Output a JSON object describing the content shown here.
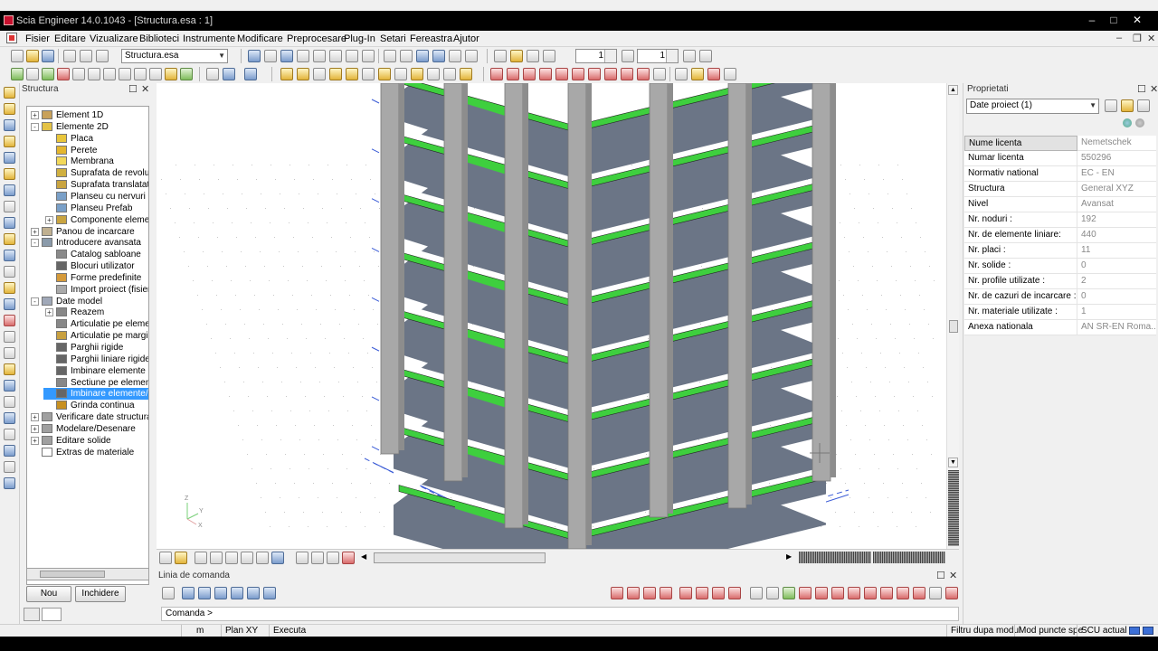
{
  "window": {
    "title": "Scia Engineer 14.0.1043 - [Structura.esa : 1]"
  },
  "menu": {
    "items": [
      "Fisier",
      "Editare",
      "Vizualizare",
      "Biblioteci",
      "Instrumente",
      "Modificare",
      "Preprocesare",
      "Plug-In",
      "Setari",
      "Fereastra",
      "Ajutor"
    ]
  },
  "toolbar": {
    "file_combo": "Structura.esa",
    "spin1": "1",
    "spin2": "1"
  },
  "structure_panel": {
    "title": "Structura",
    "tree": [
      "Element 1D",
      "Elemente 2D",
      "Placa",
      "Perete",
      "Membrana",
      "Suprafata de revoluti",
      "Suprafata translatata",
      "Planseu cu nervuri",
      "Planseu Prefab",
      "Componente elemen",
      "Panou de incarcare",
      "Introducere avansata",
      "Catalog sabloane",
      "Blocuri utilizator",
      "Forme predefinite",
      "Import proiect (fisier",
      "Date model",
      "Reazem",
      "Articulatie pe elemen",
      "Articulatie pe margin",
      "Parghii rigide",
      "Parghii liniare rigide",
      "Imbinare elemente i",
      "Sectiune pe element",
      "Imbinare elemente/",
      "Grinda continua",
      "Verificare date structura",
      "Modelare/Desenare",
      "Editare solide",
      "Extras de materiale"
    ],
    "btn_new": "Nou",
    "btn_close": "Inchidere"
  },
  "command_panel": {
    "title": "Linia de comanda",
    "prompt": "Comanda >"
  },
  "properties": {
    "title": "Proprietati",
    "combo": "Date proiect (1)",
    "rows": [
      {
        "k": "Nume licenta",
        "v": "Nemetschek"
      },
      {
        "k": "Numar licenta",
        "v": "550296"
      },
      {
        "k": "Normativ national",
        "v": "EC - EN"
      },
      {
        "k": "Structura",
        "v": "General XYZ"
      },
      {
        "k": "Nivel",
        "v": "Avansat"
      },
      {
        "k": "Nr. noduri :",
        "v": "192"
      },
      {
        "k": "Nr. de elemente liniare:",
        "v": "440"
      },
      {
        "k": "Nr. placi :",
        "v": "11"
      },
      {
        "k": "Nr. solide :",
        "v": "0"
      },
      {
        "k": "Nr. profile utilizate :",
        "v": "2"
      },
      {
        "k": "Nr. de cazuri de incarcare :",
        "v": "0"
      },
      {
        "k": "Nr. materiale utilizate :",
        "v": "1"
      },
      {
        "k": "Anexa nationala",
        "v": "AN SR-EN Roma..."
      }
    ]
  },
  "axes": {
    "z": "Z",
    "y": "Y",
    "x": "X"
  },
  "status": {
    "unit": "m",
    "plane": "Plan XY",
    "mode": "Executa",
    "filter": "Filtru dupa modul",
    "snap": "Mod puncte spe",
    "ucs": "SCU actual"
  },
  "colors": {
    "beam": "#3ecf3e",
    "slab": "#6b7586",
    "column": "#a8a8a8",
    "selection": "#3399ff",
    "titlebar": "#000000"
  }
}
